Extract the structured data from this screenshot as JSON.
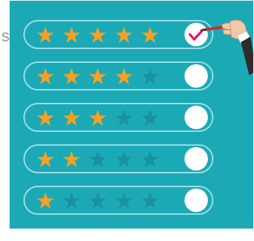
{
  "page": {
    "cut_text": "s"
  },
  "colors": {
    "panel": "#1ca9b6",
    "star_filled": "#f4a125",
    "star_empty": "#18929d",
    "row_border": "#9ee0e6",
    "check": "#e8166e",
    "pen": "#d22a2a",
    "sleeve": "#2c2c2c"
  },
  "rating_rows": [
    {
      "rating": 5,
      "max": 5,
      "selected": true
    },
    {
      "rating": 4,
      "max": 5,
      "selected": false
    },
    {
      "rating": 3,
      "max": 5,
      "selected": false
    },
    {
      "rating": 2,
      "max": 5,
      "selected": false
    },
    {
      "rating": 1,
      "max": 5,
      "selected": false
    }
  ],
  "icons": {
    "filled_star": "star-icon",
    "empty_star": "star-empty-icon",
    "check": "checkmark-icon",
    "hand": "hand-with-pen-icon"
  }
}
